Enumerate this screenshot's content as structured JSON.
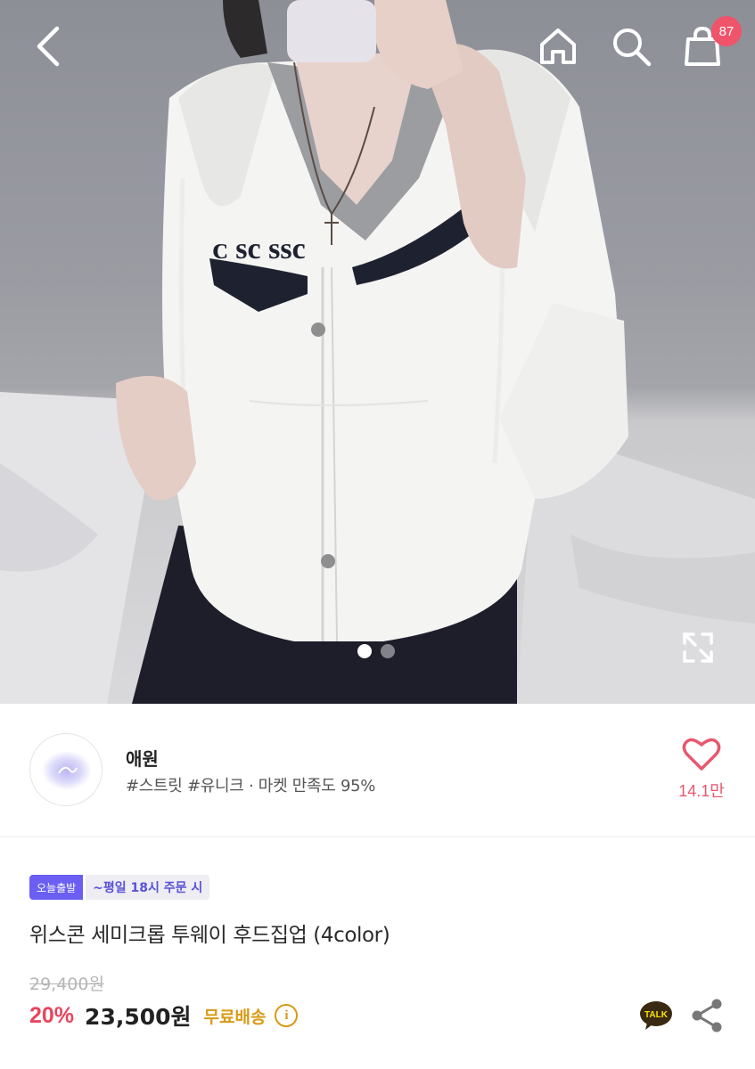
{
  "header": {
    "back_icon": "chevron-left-icon",
    "home_icon": "home-icon",
    "search_icon": "search-icon",
    "cart_icon": "shopping-bag-icon",
    "cart_count": "87"
  },
  "gallery": {
    "current_index": 1,
    "total": 2,
    "expand_icon": "expand-icon"
  },
  "store": {
    "name": "애원",
    "meta": "#스트릿 #유니크 · 마켓 만족도 95%",
    "like_icon": "heart-icon",
    "likes": "14.1만"
  },
  "product": {
    "badge_today": "오늘출발",
    "badge_time": "~평일 18시 주문 시",
    "title": "위스콘 세미크롭 투웨이 후드집업 (4color)",
    "original_price": "29,400원",
    "discount": "20%",
    "price": "23,500원",
    "shipping": "무료배송",
    "info_glyph": "i",
    "talk_label": "TALK",
    "share_icon": "share-icon"
  },
  "colors": {
    "accent_red": "#e8465e",
    "badge_purple": "#6a5ff2",
    "shipping_gold": "#d99a14",
    "kakao_yellow": "#f9e000"
  }
}
